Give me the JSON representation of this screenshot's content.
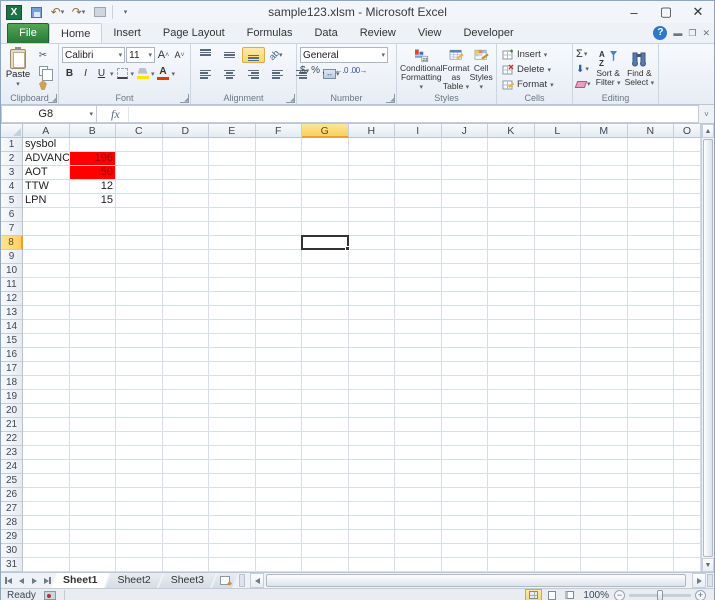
{
  "window": {
    "title": "sample123.xlsm  -  Microsoft Excel"
  },
  "ribbon_tabs": {
    "file": "File",
    "items": [
      "Home",
      "Insert",
      "Page Layout",
      "Formulas",
      "Data",
      "Review",
      "View",
      "Developer"
    ],
    "active": "Home"
  },
  "ribbon": {
    "clipboard": {
      "paste": "Paste",
      "label": "Clipboard"
    },
    "font": {
      "name": "Calibri",
      "size": "11",
      "bold": "B",
      "italic": "I",
      "underline": "U",
      "grow": "A",
      "shrink": "A",
      "label": "Font"
    },
    "alignment": {
      "orientation": "ab",
      "wrap": "↵",
      "merge": "⇔",
      "label": "Alignment"
    },
    "number": {
      "format": "General",
      "currency": "$",
      "percent": "%",
      "comma": ",",
      "inc_dec": ".0",
      "dec_dec": ".00",
      "label": "Number"
    },
    "styles": {
      "items": [
        {
          "line1": "Conditional",
          "line2": "Formatting"
        },
        {
          "line1": "Format as",
          "line2": "Table"
        },
        {
          "line1": "Cell",
          "line2": "Styles"
        }
      ],
      "label": "Styles"
    },
    "cells": {
      "insert": "Insert",
      "delete": "Delete",
      "format": "Format",
      "label": "Cells"
    },
    "editing": {
      "autosum": "Σ",
      "items": [
        {
          "line1": "Sort &",
          "line2": "Filter"
        },
        {
          "line1": "Find &",
          "line2": "Select"
        }
      ],
      "label": "Editing"
    }
  },
  "formula_bar": {
    "name_box": "G8",
    "fx": "fx",
    "content": ""
  },
  "grid": {
    "columns": [
      "A",
      "B",
      "C",
      "D",
      "E",
      "F",
      "G",
      "H",
      "I",
      "J",
      "K",
      "L",
      "M",
      "N",
      "O"
    ],
    "partial_last_column": true,
    "row_count": 31,
    "selected_cell": "G8",
    "selected_column": "G",
    "selected_row": 8,
    "cells": [
      {
        "ref": "A1",
        "value": "sysbol"
      },
      {
        "ref": "A2",
        "value": "ADVANC"
      },
      {
        "ref": "B2",
        "value": "196",
        "fill": "#ff0000",
        "color": "#9c0006",
        "align": "right"
      },
      {
        "ref": "A3",
        "value": "AOT"
      },
      {
        "ref": "B3",
        "value": "50",
        "fill": "#ff0000",
        "color": "#9c0006",
        "align": "right"
      },
      {
        "ref": "A4",
        "value": "TTW"
      },
      {
        "ref": "B4",
        "value": "12",
        "align": "right"
      },
      {
        "ref": "A5",
        "value": "LPN"
      },
      {
        "ref": "B5",
        "value": "15",
        "align": "right"
      }
    ]
  },
  "sheet_tabs": {
    "tabs": [
      "Sheet1",
      "Sheet2",
      "Sheet3"
    ],
    "active": "Sheet1"
  },
  "status_bar": {
    "mode": "Ready",
    "zoom": "100%"
  },
  "colors": {
    "selection_highlight": "#fbd05e",
    "cell_fill_red": "#ff0000",
    "accent_green": "#1e7145"
  }
}
